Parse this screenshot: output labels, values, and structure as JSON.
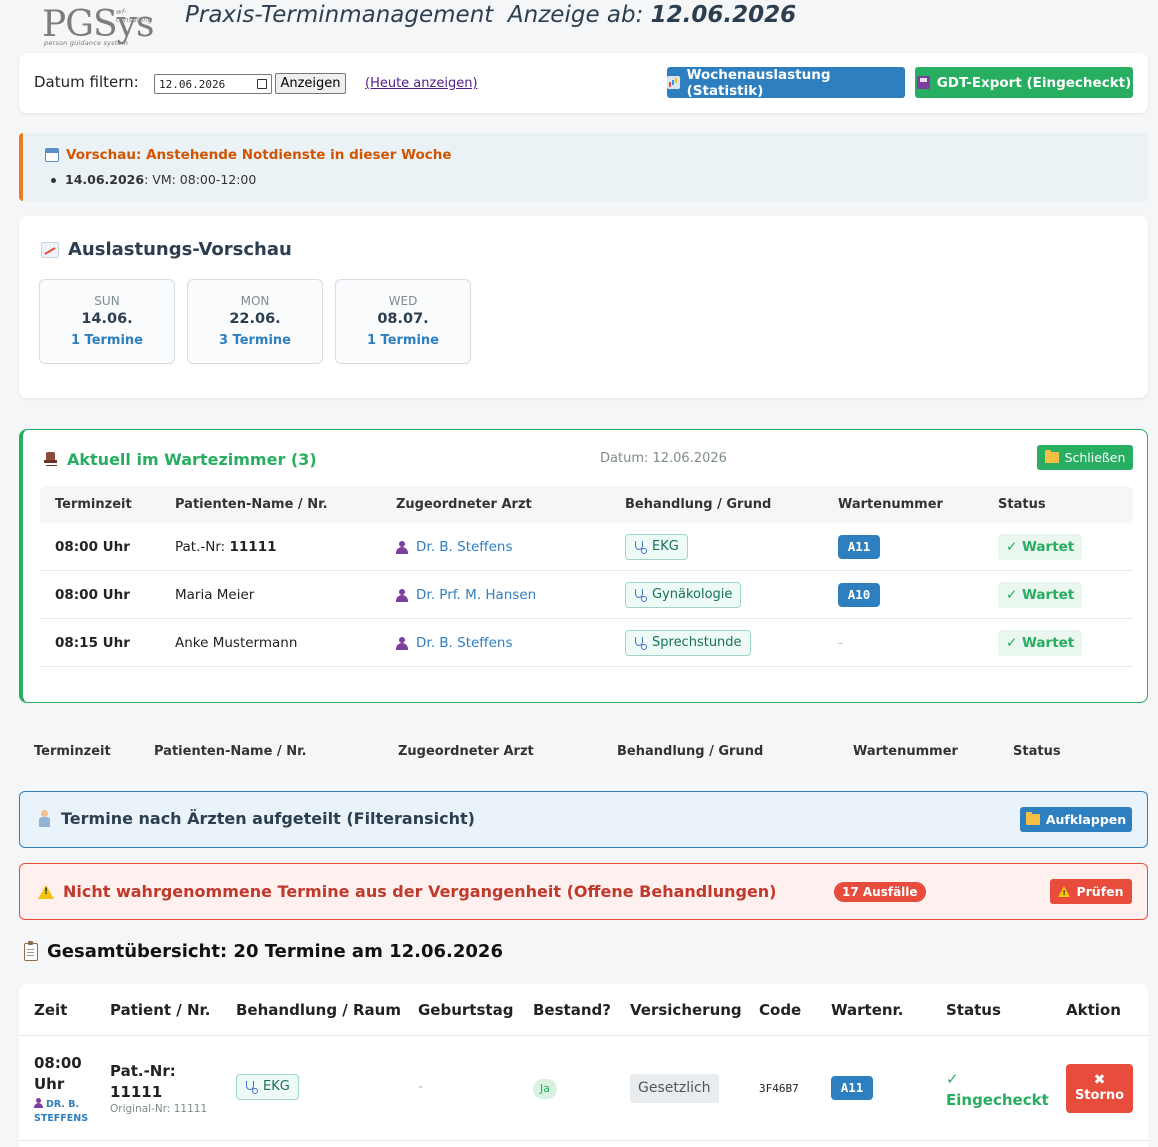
{
  "header": {
    "logo_text": "PGSys",
    "logo_tagline_top": "wf-consulting",
    "logo_tagline_bottom": "person guidance system",
    "title": "Praxis-Terminmanagement",
    "date_prefix": "Anzeige ab:",
    "date": "12.06.2026"
  },
  "filter": {
    "label": "Datum filtern:",
    "date_value": "12.06.2026",
    "show_button": "Anzeigen",
    "today_link": "(Heute anzeigen)",
    "stats_button": "Wochenauslastung (Statistik)",
    "gdt_button": "GDT-Export (Eingecheckt)",
    "stats_color": "#2e7fc0",
    "gdt_color": "#27ae60"
  },
  "notdienst": {
    "title": "Vorschau: Anstehende Notdienste in dieser Woche",
    "items": [
      {
        "date": "14.06.2026",
        "text": ": VM: 08:00-12:00"
      }
    ]
  },
  "preview": {
    "title": "Auslastungs-Vorschau",
    "days": [
      {
        "weekday": "SUN",
        "date": "14.06.",
        "count": "1 Termine"
      },
      {
        "weekday": "MON",
        "date": "22.06.",
        "count": "3 Termine"
      },
      {
        "weekday": "WED",
        "date": "08.07.",
        "count": "1 Termine"
      }
    ]
  },
  "waiting": {
    "title": "Aktuell im Wartezimmer (3)",
    "date_label": "Datum: 12.06.2026",
    "close_button": "Schließen",
    "columns": [
      "Terminzeit",
      "Patienten-Name / Nr.",
      "Zugeordneter Arzt",
      "Behandlung / Grund",
      "Wartenummer",
      "Status"
    ],
    "rows": [
      {
        "time": "08:00 Uhr",
        "patient_prefix": "Pat.-Nr: ",
        "patient_bold": "11111",
        "doctor": "Dr. B. Steffens",
        "treatment": "EKG",
        "number": "A11",
        "status": "✓ Wartet"
      },
      {
        "time": "08:00 Uhr",
        "patient_prefix": "Maria Meier",
        "patient_bold": "",
        "doctor": "Dr. Prf. M. Hansen",
        "treatment": "Gynäkologie",
        "number": "A10",
        "status": "✓ Wartet"
      },
      {
        "time": "08:15 Uhr",
        "patient_prefix": "Anke Mustermann",
        "patient_bold": "",
        "doctor": "Dr. B. Steffens",
        "treatment": "Sprechstunde",
        "number": "-",
        "status": "✓ Wartet"
      }
    ]
  },
  "empty_table": {
    "columns": [
      "Terminzeit",
      "Patienten-Name / Nr.",
      "Zugeordneter Arzt",
      "Behandlung / Grund",
      "Wartenummer",
      "Status"
    ]
  },
  "doctors": {
    "title": "Termine nach Ärzten aufgeteilt (Filteransicht)",
    "button": "Aufklappen"
  },
  "noshow": {
    "title": "Nicht wahrgenommene Termine aus der Vergangenheit (Offene Behandlungen)",
    "badge": "17 Ausfälle",
    "button": "Prüfen"
  },
  "overview": {
    "title": "Gesamtübersicht: 20 Termine am 12.06.2026",
    "columns": [
      "Zeit",
      "Patient / Nr.",
      "Behandlung / Raum",
      "Geburtstag",
      "Bestand?",
      "Versicherung",
      "Code",
      "Wartenr.",
      "Status",
      "Aktion"
    ],
    "rows": [
      {
        "time": "08:00 Uhr",
        "doctor": "DR. B. STEFFENS",
        "patient": "Pat.-Nr: 11111",
        "original_nr": "Original-Nr: 11111",
        "treatment": "EKG",
        "birthday": "-",
        "existing": "Ja",
        "insurance": "Gesetzlich",
        "code": "3F46B7",
        "number": "A11",
        "status": "✓ Eingecheckt",
        "action": "Storno"
      }
    ]
  }
}
